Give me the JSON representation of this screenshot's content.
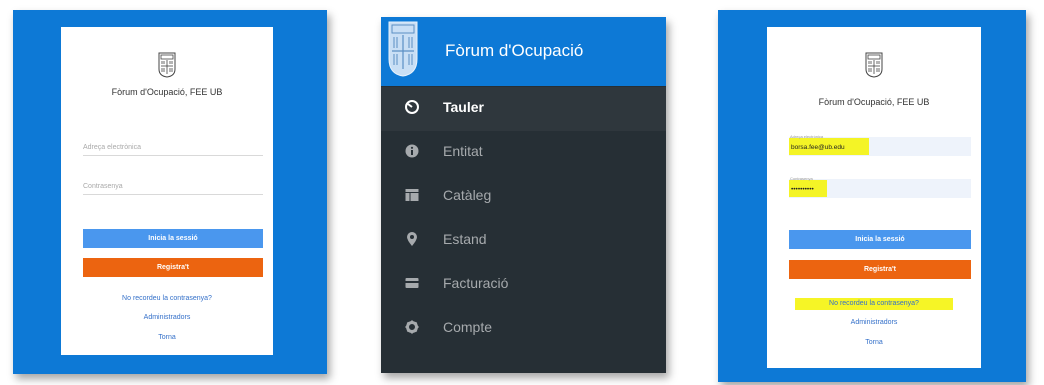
{
  "login_form": {
    "brand": "Fòrum d'Ocupació, FEE UB",
    "email_placeholder": "Adreça electrònica",
    "password_placeholder": "Contrasenya",
    "login_button": "Inicia la sessió",
    "register_button": "Registra't",
    "forgot_link": "No recordeu la contrasenya?",
    "admin_link": "Administradors",
    "back_link": "Torna"
  },
  "sidebar": {
    "title": "Fòrum d'Ocupació",
    "items": [
      {
        "label": "Tauler",
        "icon": "dashboard-icon",
        "active": true
      },
      {
        "label": "Entitat",
        "icon": "info-icon",
        "active": false
      },
      {
        "label": "Catàleg",
        "icon": "catalog-icon",
        "active": false
      },
      {
        "label": "Estand",
        "icon": "map-marker-icon",
        "active": false
      },
      {
        "label": "Facturació",
        "icon": "credit-card-icon",
        "active": false
      },
      {
        "label": "Compte",
        "icon": "gear-icon",
        "active": false
      }
    ]
  },
  "login_filled": {
    "brand": "Fòrum d'Ocupació, FEE UB",
    "email_label": "Adreça electrònica",
    "email_value": "borsa.fee@ub.edu",
    "password_label": "Contrasenya",
    "password_value": "••••••••••",
    "login_button": "Inicia la sessió",
    "register_button": "Registra't",
    "forgot_link": "No recordeu la contrasenya?",
    "admin_link": "Administradors",
    "back_link": "Torna"
  },
  "colors": {
    "brand_blue": "#0d79d6",
    "button_blue": "#4a97ee",
    "button_orange": "#ec6410",
    "sidebar_dark": "#262f35",
    "highlight": "#f4f300"
  }
}
